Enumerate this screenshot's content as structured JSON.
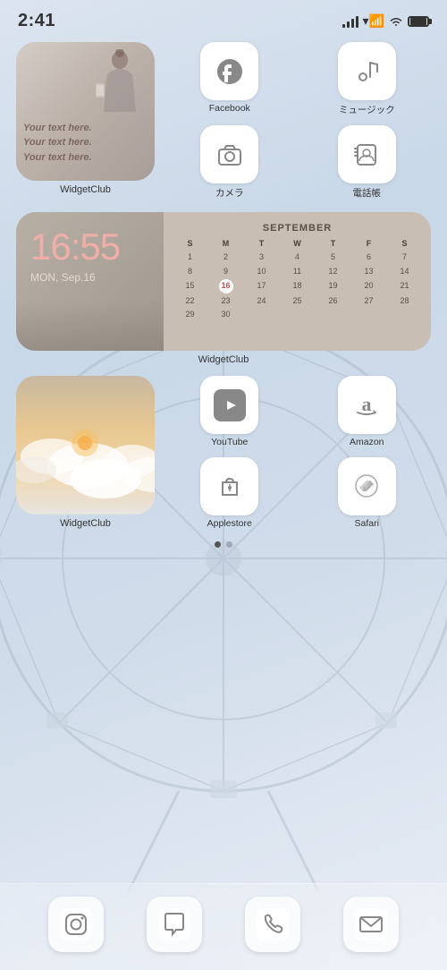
{
  "statusBar": {
    "time": "2:41",
    "signal": "signal",
    "wifi": "wifi",
    "battery": "battery"
  },
  "topWidgets": {
    "widgetClub": {
      "label": "WidgetClub",
      "text": "Your text here.\nYour text here.\nYour text here."
    },
    "icons": [
      {
        "id": "facebook",
        "label": "Facebook"
      },
      {
        "id": "music",
        "label": "ミュージック"
      },
      {
        "id": "camera",
        "label": "カメラ"
      },
      {
        "id": "contacts",
        "label": "電話帳"
      }
    ]
  },
  "calendarWidget": {
    "label": "WidgetClub",
    "time": "16:55",
    "date": "MON, Sep.16",
    "month": "SEPTEMBER",
    "headers": [
      "S",
      "M",
      "T",
      "W",
      "T",
      "F",
      "S"
    ],
    "rows": [
      [
        "1",
        "2",
        "3",
        "4",
        "5",
        "6",
        "7"
      ],
      [
        "8",
        "9",
        "10",
        "11",
        "12",
        "13",
        "14"
      ],
      [
        "15",
        "16",
        "17",
        "18",
        "19",
        "20",
        "21"
      ],
      [
        "22",
        "23",
        "24",
        "25",
        "26",
        "27",
        "28"
      ],
      [
        "29",
        "30",
        "",
        "",
        "",
        "",
        ""
      ]
    ],
    "today": "16"
  },
  "bottomSection": {
    "widgetClubLabel": "WidgetClub",
    "icons": [
      {
        "id": "youtube",
        "label": "YouTube"
      },
      {
        "id": "amazon",
        "label": "Amazon"
      },
      {
        "id": "appstore",
        "label": "Applestore"
      },
      {
        "id": "safari",
        "label": "Safari"
      }
    ]
  },
  "pageDots": {
    "active": 0,
    "count": 2
  },
  "dock": {
    "icons": [
      {
        "id": "instagram",
        "label": "Instagram"
      },
      {
        "id": "messages",
        "label": "Messages"
      },
      {
        "id": "phone",
        "label": "Phone"
      },
      {
        "id": "mail",
        "label": "Mail"
      }
    ]
  }
}
